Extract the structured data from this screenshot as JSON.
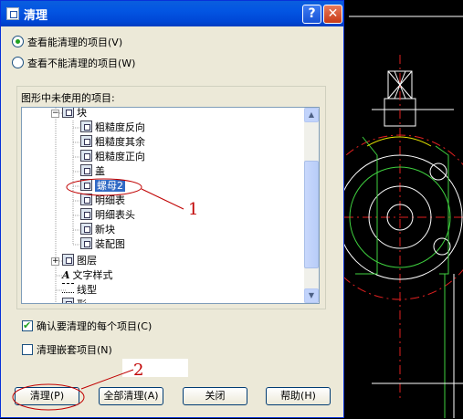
{
  "window": {
    "title": "清理"
  },
  "title_buttons": {
    "help": "?",
    "close": "✕"
  },
  "radios": [
    {
      "label": "查看能清理的项目(V)",
      "checked": true
    },
    {
      "label": "查看不能清理的项目(W)",
      "checked": false
    }
  ],
  "tree": {
    "label": "图形中未使用的项目:",
    "block_node": "块",
    "blocks": [
      "粗糙度反向",
      "粗糙度其余",
      "粗糙度正向",
      "盖",
      "螺母2",
      "明细表",
      "明细表头",
      "新块",
      "装配图"
    ],
    "selected": "螺母2",
    "layers": "图层",
    "text_styles": "文字样式",
    "linetypes": "线型",
    "shapes": "形"
  },
  "checkboxes": {
    "confirm": {
      "label": "确认要清理的每个项目(C)",
      "checked": true
    },
    "nested": {
      "label": "清理嵌套项目(N)",
      "checked": false
    }
  },
  "buttons": {
    "purge": "清理(P)",
    "purge_all": "全部清理(A)",
    "close": "关闭",
    "help": "帮助(H)"
  },
  "annotations": {
    "one": "1",
    "two": "2"
  }
}
